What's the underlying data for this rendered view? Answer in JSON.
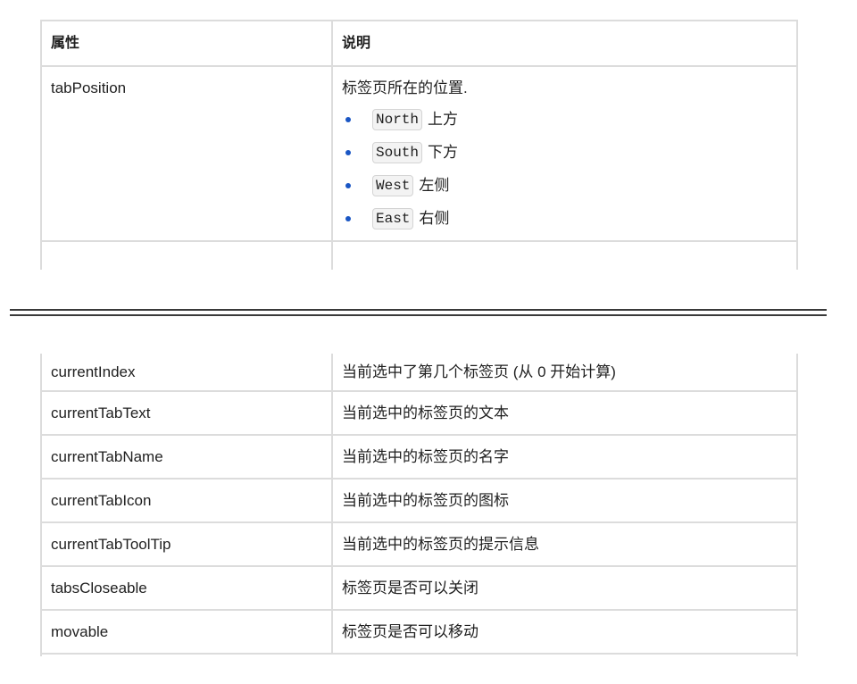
{
  "top_table": {
    "header": {
      "attr": "属性",
      "desc": "说明"
    },
    "tab_position": {
      "name": "tabPosition",
      "desc": "标签页所在的位置.",
      "options": [
        {
          "code": "North",
          "text": "上方"
        },
        {
          "code": "South",
          "text": "下方"
        },
        {
          "code": "West",
          "text": "左侧"
        },
        {
          "code": "East",
          "text": "右侧"
        }
      ]
    }
  },
  "bottom_table": {
    "rows": [
      {
        "name": "currentIndex",
        "desc": "当前选中了第几个标签页 (从 0 开始计算)"
      },
      {
        "name": "currentTabText",
        "desc": "当前选中的标签页的文本"
      },
      {
        "name": "currentTabName",
        "desc": "当前选中的标签页的名字"
      },
      {
        "name": "currentTabIcon",
        "desc": "当前选中的标签页的图标"
      },
      {
        "name": "currentTabToolTip",
        "desc": "当前选中的标签页的提示信息"
      },
      {
        "name": "tabsCloseable",
        "desc": "标签页是否可以关闭"
      },
      {
        "name": "movable",
        "desc": "标签页是否可以移动"
      }
    ]
  },
  "colors": {
    "bullet": "#1a56c4",
    "border": "#dcdcdc",
    "divider": "#3a3a3a"
  }
}
